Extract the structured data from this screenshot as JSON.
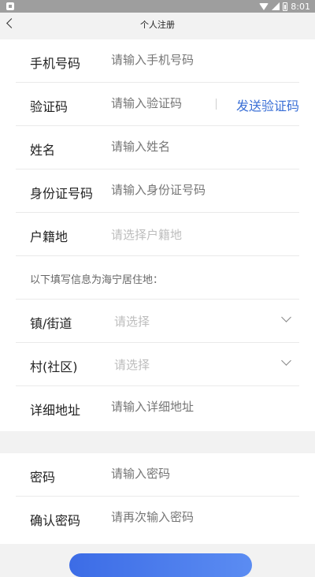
{
  "status_bar": {
    "time": "8:01"
  },
  "header": {
    "title": "个人注册"
  },
  "form": {
    "phone": {
      "label": "手机号码",
      "placeholder": "请输入手机号码"
    },
    "code": {
      "label": "验证码",
      "placeholder": "请输入验证码",
      "send_label": "发送验证码"
    },
    "name": {
      "label": "姓名",
      "placeholder": "请输入姓名"
    },
    "id_number": {
      "label": "身份证号码",
      "placeholder": "请输入身份证号码"
    },
    "household": {
      "label": "户籍地",
      "placeholder": "请选择户籍地"
    },
    "residence_note": "以下填写信息为海宁居住地：",
    "town": {
      "label": "镇/街道",
      "placeholder": "请选择"
    },
    "village": {
      "label": "村(社区)",
      "placeholder": "请选择"
    },
    "address": {
      "label": "详细地址",
      "placeholder": "请输入详细地址"
    },
    "password": {
      "label": "密码",
      "placeholder": "请输入密码"
    },
    "confirm_password": {
      "label": "确认密码",
      "placeholder": "请再次输入密码"
    }
  },
  "colors": {
    "accent": "#3a6fd6",
    "placeholder": "#bdbdbd",
    "background": "#f2f2f2"
  }
}
